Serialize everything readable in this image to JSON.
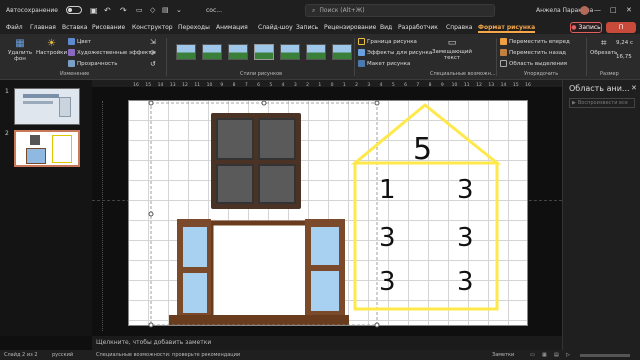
{
  "titlebar": {
    "autosave": "Автосохранение",
    "doc_name": "сос...",
    "search_placeholder": "Поиск (Alt+Ж)",
    "user_name": "Анжела Паракина"
  },
  "menu": {
    "tabs": [
      "Файл",
      "Главная",
      "Вставка",
      "Рисование",
      "Конструктор",
      "Переходы",
      "Анимация",
      "Слайд-шоу",
      "Запись",
      "Рецензирование",
      "Вид",
      "Разработчик",
      "Справка",
      "Формат рисунка"
    ],
    "record": "Запись",
    "share": "П"
  },
  "ribbon": {
    "remove_bg": "Удалить фон",
    "corrections": "Настройки",
    "color": "Цвет",
    "artistic": "Художественные эффекты",
    "transparency": "Прозрачность",
    "group_change": "Изменение",
    "group_styles": "Стили рисунков",
    "border": "Граница рисунка",
    "effects": "Эффекты для рисунка",
    "layout": "Макет рисунка",
    "alt_text": "Замещающий текст",
    "group_access": "Специальные возможн...",
    "bring_forward": "Переместить вперед",
    "send_backward": "Переместить назад",
    "selection_pane": "Область выделения",
    "group_arrange": "Упорядочить",
    "crop": "Обрезать",
    "group_size": "Размер",
    "height": "9,24 с",
    "width": "16,75"
  },
  "slides": [
    {
      "num": "1"
    },
    {
      "num": "2"
    }
  ],
  "ruler_ticks": [
    "16",
    "15",
    "14",
    "13",
    "12",
    "11",
    "10",
    "9",
    "8",
    "7",
    "6",
    "5",
    "4",
    "3",
    "2",
    "1",
    "0",
    "1",
    "2",
    "3",
    "4",
    "5",
    "6",
    "7",
    "8",
    "9",
    "10",
    "11",
    "12",
    "13",
    "14",
    "15",
    "16"
  ],
  "house": {
    "roof_number": "5",
    "rows": [
      [
        "1",
        "3"
      ],
      [
        "3",
        "3"
      ],
      [
        "3",
        "3"
      ]
    ]
  },
  "notes_placeholder": "Щелкните, чтобы добавить заметки",
  "right_pane": {
    "title": "Область ани...",
    "play_label": "Воспроизвести все"
  },
  "status": {
    "slide_info": "Слайд 2 из 2",
    "language": "русский",
    "accessibility": "Специальные возможности: проверьте рекомендации",
    "notes_btn": "Заметки"
  },
  "colors": {
    "accent": "#f5a74a",
    "house_line": "#ffe84a",
    "share": "#c84a3a"
  }
}
